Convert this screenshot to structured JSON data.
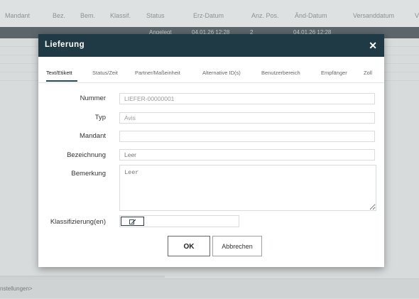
{
  "background": {
    "columns": [
      "Mandant",
      "Bez.",
      "Bem.",
      "Klassif.",
      "Status",
      "Erz-Datum",
      "Anz. Pos.",
      "Änd-Datum",
      "Versanddatum",
      "V"
    ],
    "selected_row": [
      "Angelegt",
      "04.01.26 12:28",
      "2",
      "04.01.26 12:28"
    ],
    "footer_text": "nstellungen>"
  },
  "modal": {
    "title": "Lieferung",
    "close_symbol": "✕",
    "tabs": [
      "Text/Etikett",
      "Status/Zeit",
      "Partner/Maßeinheit",
      "Alternative ID(s)",
      "Benutzerbereich",
      "Empfänger",
      "Zoll"
    ],
    "active_tab": "Text/Etikett",
    "fields": {
      "nummer": {
        "label": "Nummer",
        "value": "LIEFER-00000001"
      },
      "typ": {
        "label": "Typ",
        "value": "Avis"
      },
      "mandant": {
        "label": "Mandant",
        "value": ""
      },
      "bezeichnung": {
        "label": "Bezeichnung",
        "placeholder": "Leer"
      },
      "bemerkung": {
        "label": "Bemerkung",
        "placeholder": "Leer"
      },
      "klassifizierung": {
        "label": "Klassifizierung(en)",
        "icon": "edit-icon"
      }
    },
    "buttons": {
      "ok": "OK",
      "cancel": "Abbrechen"
    }
  }
}
